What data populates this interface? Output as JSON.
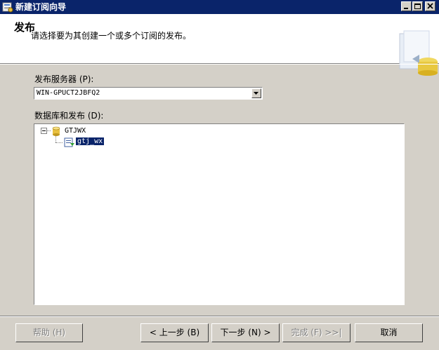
{
  "window": {
    "title": "新建订阅向导"
  },
  "header": {
    "title": "发布",
    "subtitle": "请选择要为其创建一个或多个订阅的发布。"
  },
  "publisher": {
    "label": "发布服务器 (P):",
    "value": "WIN-GPUCT2JBFQ2"
  },
  "tree": {
    "label": "数据库和发布 (D):",
    "database": "GTJWX",
    "publication": "gtj_wx"
  },
  "buttons": {
    "help": "帮助 (H)",
    "back": "< 上一步 (B)",
    "next": "下一步 (N) >",
    "finish": "完成 (F) >>|",
    "cancel": "取消"
  },
  "colors": {
    "titlebar": "#0a246a",
    "face": "#d4d0c8",
    "selection": "#0a246a"
  }
}
